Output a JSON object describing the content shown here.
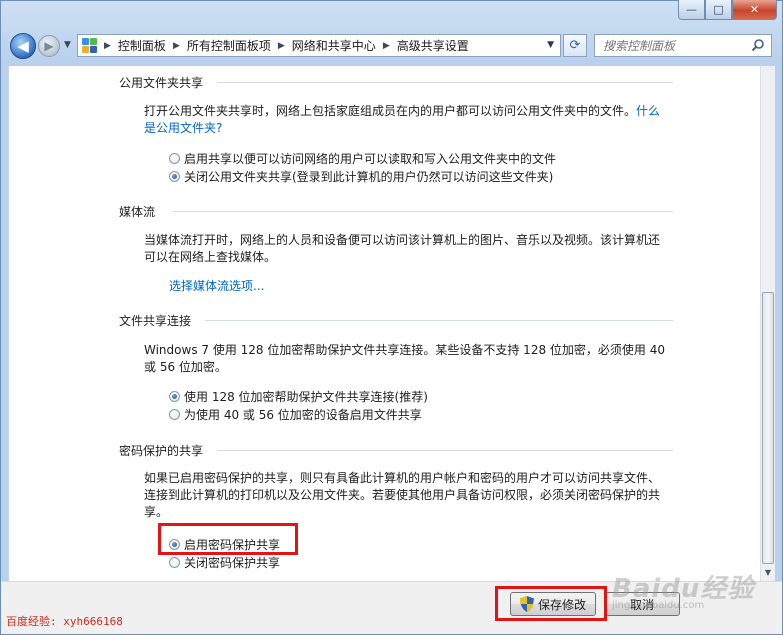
{
  "window": {
    "minimize": "—",
    "maximize": "□",
    "close": "✕"
  },
  "nav": {
    "back": "◀",
    "forward": "▶",
    "dropdown": "▼"
  },
  "address": {
    "crumbs": [
      "控制面板",
      "所有控制面板项",
      "网络和共享中心",
      "高级共享设置"
    ],
    "arrow": "▶",
    "dropdown": "▼"
  },
  "refresh": "⟳",
  "search": {
    "placeholder": "搜索控制面板"
  },
  "sections": {
    "public_folder": {
      "title": "公用文件夹共享",
      "desc_line1": "打开公用文件夹共享时，网络上包括家庭组成员在内的用户都可以访问公用文件夹中的文件。",
      "link_part1": "什么",
      "link_part2": "是公用文件夹?",
      "opt_on": "启用共享以便可以访问网络的用户可以读取和写入公用文件夹中的文件",
      "opt_off": "关闭公用文件夹共享(登录到此计算机的用户仍然可以访问这些文件夹)"
    },
    "media_stream": {
      "title": "媒体流",
      "desc_line1": "当媒体流打开时，网络上的人员和设备便可以访问该计算机上的图片、音乐以及视频。该计算机还",
      "desc_line2": "可以在网络上查找媒体。",
      "link": "选择媒体流选项..."
    },
    "file_sharing": {
      "title": "文件共享连接",
      "desc_line1": "Windows 7 使用 128 位加密帮助保护文件共享连接。某些设备不支持 128 位加密，必须使用 40",
      "desc_line2": "或 56 位加密。",
      "opt_128": "使用 128 位加密帮助保护文件共享连接(推荐)",
      "opt_40": "为使用 40 或 56 位加密的设备启用文件共享"
    },
    "password": {
      "title": "密码保护的共享",
      "desc_line1": "如果已启用密码保护的共享，则只有具备此计算机的用户帐户和密码的用户才可以访问共享文件、",
      "desc_line2": "连接到此计算机的打印机以及公用文件夹。若要使其他用户具备访问权限，必须关闭密码保护的共",
      "desc_line3": "享。",
      "opt_on": "启用密码保护共享",
      "opt_off": "关闭密码保护共享"
    }
  },
  "buttons": {
    "save": "保存修改",
    "cancel": "取消"
  },
  "watermark": {
    "left": "百度经验: xyh666168",
    "right": "Baidu经验",
    "right_sub": "jingyan.baidu.com"
  },
  "colors": {
    "link": "#0066cc",
    "highlight": "#e21414"
  }
}
